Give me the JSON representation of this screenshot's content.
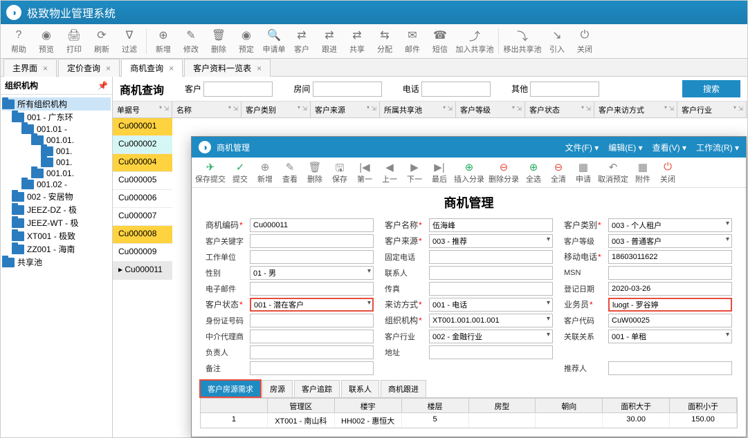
{
  "app_title": "极致物业管理系统",
  "toolbar": [
    {
      "icon": "?",
      "label": "帮助"
    },
    {
      "icon": "◉",
      "label": "预览"
    },
    {
      "icon": "🖨",
      "label": "打印"
    },
    {
      "icon": "⟳",
      "label": "刷新"
    },
    {
      "icon": "∇",
      "label": "过滤"
    },
    {
      "sep": true
    },
    {
      "icon": "⊕",
      "label": "新增"
    },
    {
      "icon": "✎",
      "label": "修改"
    },
    {
      "icon": "🗑",
      "label": "删除"
    },
    {
      "icon": "◉",
      "label": "预定"
    },
    {
      "icon": "🔍",
      "label": "申请单"
    },
    {
      "icon": "⇄",
      "label": "客户"
    },
    {
      "icon": "⇄",
      "label": "跟进"
    },
    {
      "icon": "⇄",
      "label": "共享"
    },
    {
      "icon": "⇆",
      "label": "分配"
    },
    {
      "icon": "✉",
      "label": "邮件"
    },
    {
      "icon": "☎",
      "label": "短信"
    },
    {
      "icon": "⤴",
      "label": "加入共享池",
      "wide": true
    },
    {
      "sep": true
    },
    {
      "icon": "⤵",
      "label": "移出共享池",
      "wide": true
    },
    {
      "icon": "↘",
      "label": "引入"
    },
    {
      "icon": "⏻",
      "label": "关闭"
    }
  ],
  "tabs": [
    {
      "label": "主界面"
    },
    {
      "label": "定价查询"
    },
    {
      "label": "商机查询",
      "active": true
    },
    {
      "label": "客户资料一览表"
    }
  ],
  "side_title": "组织机构",
  "tree": [
    {
      "l": "所有组织机构",
      "ind": 0,
      "sel": true
    },
    {
      "l": "001 - 广东环",
      "ind": 1
    },
    {
      "l": "001.01 -",
      "ind": 2
    },
    {
      "l": "001.01.",
      "ind": 3
    },
    {
      "l": "001.",
      "ind": 4
    },
    {
      "l": "001.",
      "ind": 4
    },
    {
      "l": "001.01.",
      "ind": 3
    },
    {
      "l": "001.02 -",
      "ind": 2
    },
    {
      "l": "002 - 安居物",
      "ind": 1
    },
    {
      "l": "JEEZ-DZ - 极",
      "ind": 1
    },
    {
      "l": "JEEZ-WT - 极",
      "ind": 1
    },
    {
      "l": "XT001 - 极致",
      "ind": 1
    },
    {
      "l": "ZZ001 - 海南",
      "ind": 1
    },
    {
      "l": "共享池",
      "ind": 0
    }
  ],
  "query": {
    "title": "商机查询",
    "f1": "客户",
    "f2": "房间",
    "f3": "电话",
    "f4": "其他",
    "btn": "搜索"
  },
  "grid_headers": [
    "单据号",
    "名称",
    "客户类别",
    "客户来源",
    "所属共享池",
    "客户等级",
    "客户状态",
    "客户来访方式",
    "客户行业"
  ],
  "grid_rows": [
    {
      "v": "Cu000001",
      "c": "y"
    },
    {
      "v": "Cu000002",
      "c": "c"
    },
    {
      "v": "Cu000004",
      "c": "y"
    },
    {
      "v": "Cu000005",
      "c": ""
    },
    {
      "v": "Cu000006",
      "c": ""
    },
    {
      "v": "Cu000007",
      "c": ""
    },
    {
      "v": "Cu000008",
      "c": "y"
    },
    {
      "v": "Cu000009",
      "c": ""
    },
    {
      "v": "Cu000011",
      "c": "s"
    }
  ],
  "dialog": {
    "title": "商机管理",
    "menus": [
      "文件(F)",
      "编辑(E)",
      "查看(V)",
      "工作流(R)"
    ],
    "toolbar": [
      {
        "i": "✈",
        "c": "g",
        "l": "保存提交",
        "w": true
      },
      {
        "i": "✓",
        "c": "g",
        "l": "提交"
      },
      {
        "i": "⊕",
        "c": "b",
        "l": "新增"
      },
      {
        "i": "✎",
        "c": "b",
        "l": "查看"
      },
      {
        "i": "🗑",
        "c": "b",
        "l": "删除"
      },
      {
        "i": "🖫",
        "c": "b",
        "l": "保存"
      },
      {
        "i": "|◀",
        "c": "b",
        "l": "第一"
      },
      {
        "i": "◀",
        "c": "b",
        "l": "上一"
      },
      {
        "i": "▶",
        "c": "b",
        "l": "下一"
      },
      {
        "i": "▶|",
        "c": "b",
        "l": "最后"
      },
      {
        "i": "⊕",
        "c": "g",
        "l": "插入分录",
        "w": true
      },
      {
        "i": "⊖",
        "c": "r",
        "l": "删除分录",
        "w": true
      },
      {
        "i": "⊕",
        "c": "g",
        "l": "全选"
      },
      {
        "i": "⊖",
        "c": "r",
        "l": "全清"
      },
      {
        "i": "▦",
        "c": "b",
        "l": "申请"
      },
      {
        "i": "↶",
        "c": "b",
        "l": "取消预定",
        "w": true
      },
      {
        "i": "▦",
        "c": "b",
        "l": "附件"
      },
      {
        "i": "⏻",
        "c": "r",
        "l": "关闭"
      }
    ],
    "form_title": "商机管理",
    "fields": {
      "code_l": "商机编码",
      "code": "Cu000011",
      "kw_l": "客户关键字",
      "kw": "",
      "work_l": "工作单位",
      "work": "",
      "sex_l": "性别",
      "sex": "01 - 男",
      "email_l": "电子邮件",
      "email": "",
      "status_l": "客户状态",
      "status": "001 - 潜在客户",
      "id_l": "身份证号码",
      "id": "",
      "agent_l": "中介代理商",
      "agent": "",
      "resp_l": "负责人",
      "resp": "",
      "remark_l": "备注",
      "remark": "",
      "name_l": "客户名称",
      "name": "伍海峰",
      "src_l": "客户来源",
      "src": "003 - 推荐",
      "tel_l": "固定电话",
      "tel": "",
      "contact_l": "联系人",
      "contact": "",
      "fax_l": "传真",
      "fax": "",
      "visit_l": "来访方式",
      "visit": "001 - 电话",
      "org_l": "组织机构",
      "org": "XT001.001.001.001",
      "ind_l": "客户行业",
      "ind": "002 - 金融行业",
      "addr_l": "地址",
      "addr": "",
      "cat_l": "客户类别",
      "cat": "003 - 个人租户",
      "lvl_l": "客户等级",
      "lvl": "003 - 普通客户",
      "mob_l": "移动电话",
      "mob": "18603011622",
      "msn_l": "MSN",
      "msn": "",
      "date_l": "登记日期",
      "date": "2020-03-26",
      "sales_l": "业务员",
      "sales": "luogt - 罗谷婷",
      "ccode_l": "客户代码",
      "ccode": "CuW00025",
      "rel_l": "关联关系",
      "rel": "001 - 单租",
      "ref_l": "推荐人",
      "ref": ""
    },
    "sub_tabs": [
      "客户房源需求",
      "房源",
      "客户追踪",
      "联系人",
      "商机跟进"
    ],
    "sub_headers": [
      "",
      "管理区",
      "楼宇",
      "楼层",
      "房型",
      "朝向",
      "面积大于",
      "面积小于"
    ],
    "sub_row": [
      "1",
      "XT001 - 南山科",
      "HH002 - 惠恒大",
      "5",
      "",
      "",
      "30.00",
      "150.00"
    ]
  }
}
